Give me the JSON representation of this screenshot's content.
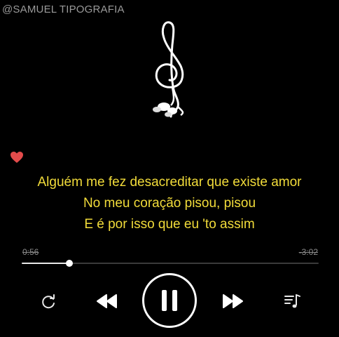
{
  "watermark": "@SAMUEL TIPOGRAFIA",
  "artwork": {
    "icon": "treble-clef-earphones-icon"
  },
  "favorite": {
    "icon": "heart-icon",
    "color": "#e34b4b"
  },
  "lyrics": {
    "color": "#f2dc3a",
    "lines": [
      "Alguém me fez desacreditar que existe amor",
      "No meu coração pisou, pisou",
      "E é por isso que eu 'to assim"
    ]
  },
  "player": {
    "elapsed": "0:56",
    "remaining": "-3:02",
    "progress": 0.16,
    "controls": {
      "repeat": "repeat-icon",
      "previous": "rewind-icon",
      "play_pause": "pause-icon",
      "next": "fast-forward-icon",
      "queue": "music-queue-icon"
    }
  }
}
